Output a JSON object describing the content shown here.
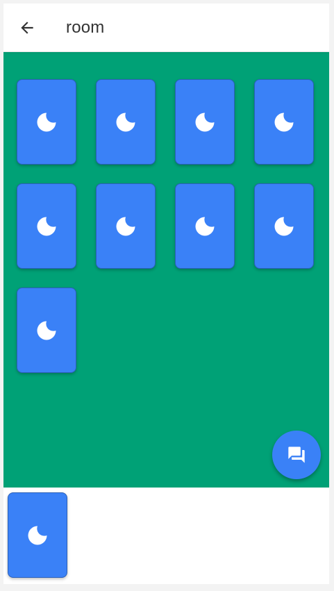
{
  "appbar": {
    "title": "room",
    "back_icon": "arrow-left-icon"
  },
  "table": {
    "background_color": "#00a176",
    "cards": [
      {
        "icon": "moon-icon"
      },
      {
        "icon": "moon-icon"
      },
      {
        "icon": "moon-icon"
      },
      {
        "icon": "moon-icon"
      },
      {
        "icon": "moon-icon"
      },
      {
        "icon": "moon-icon"
      },
      {
        "icon": "moon-icon"
      },
      {
        "icon": "moon-icon"
      },
      {
        "icon": "moon-icon"
      }
    ]
  },
  "hand": {
    "cards": [
      {
        "icon": "moon-icon"
      }
    ]
  },
  "fab": {
    "icon": "chat-icon"
  },
  "colors": {
    "card": "#3a81f7",
    "table": "#00a176",
    "text": "#333333"
  }
}
